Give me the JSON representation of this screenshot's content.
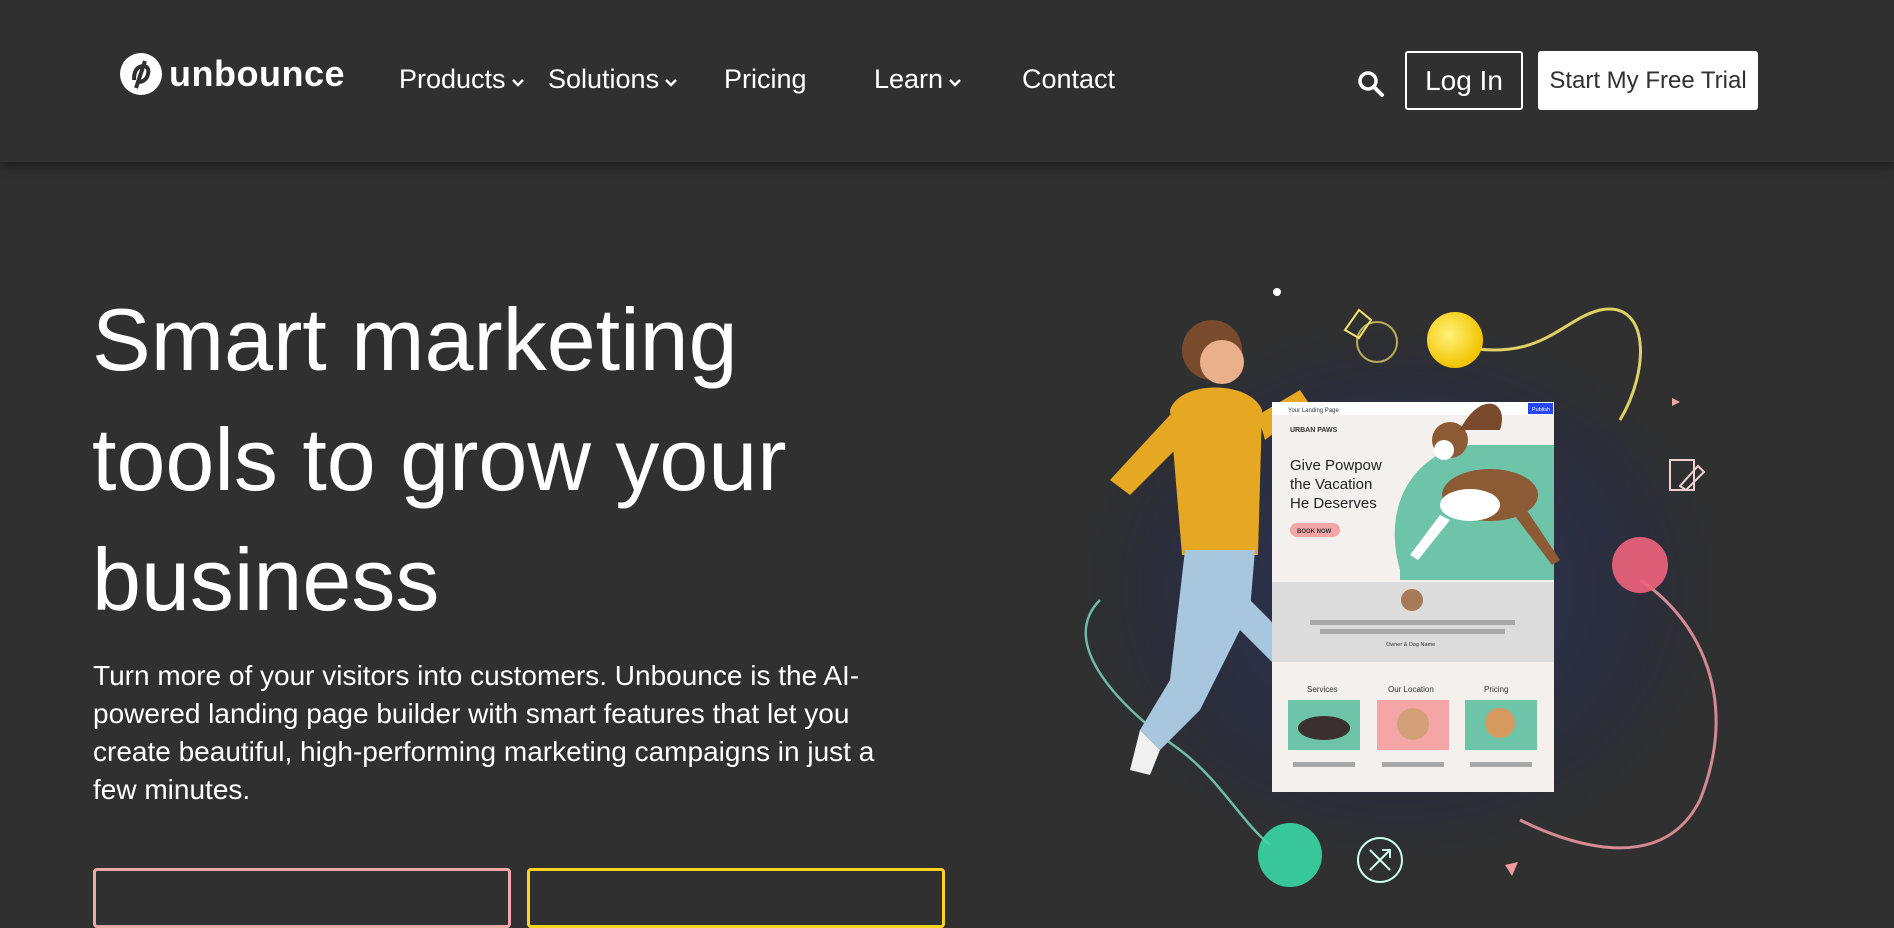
{
  "header": {
    "logo_text": "unbounce",
    "nav": {
      "products": "Products",
      "solutions": "Solutions",
      "pricing": "Pricing",
      "learn": "Learn",
      "contact": "Contact"
    },
    "login_label": "Log In",
    "trial_label": "Start My Free Trial"
  },
  "hero": {
    "title_line1": "Smart marketing",
    "title_line2": "tools to grow your",
    "title_line3": "business",
    "subtitle": "Turn more of your visitors into customers. Unbounce is the AI-powered landing page builder with smart features that let you create beautiful, high-performing marketing campaigns in just a few minutes.",
    "cta_primary_color": "#f4a6a6",
    "cta_secondary_color": "#ffd21f"
  },
  "illustration": {
    "window_title": "Your Landing Page",
    "publish_label": "Publish",
    "brand": "URBAN PAWS",
    "headline_line1": "Give Powpow",
    "headline_line2": "the Vacation",
    "headline_line3": "He Deserves",
    "book_label": "BOOK NOW",
    "owner_caption": "Owner & Dog Name",
    "col_services": "Services",
    "col_location": "Our Location",
    "col_pricing": "Pricing"
  },
  "colors": {
    "background": "#303030",
    "accent_pink": "#f4a6a6",
    "accent_yellow": "#ffd21f",
    "accent_teal": "#5fc7a8",
    "publish_blue": "#2446f5"
  }
}
